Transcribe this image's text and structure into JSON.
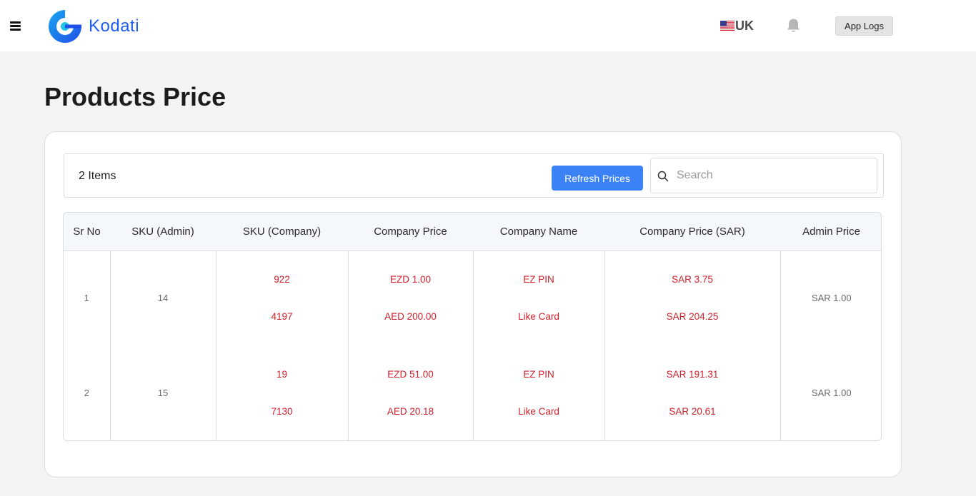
{
  "header": {
    "brand": "Kodati",
    "language": "UK",
    "app_logs_label": "App Logs"
  },
  "page": {
    "title": "Products Price"
  },
  "toolbar": {
    "items_count": "2 Items",
    "refresh_label": "Refresh Prices",
    "search_placeholder": "Search"
  },
  "table": {
    "columns": [
      "Sr No",
      "SKU (Admin)",
      "SKU (Company)",
      "Company Price",
      "Company Name",
      "Company Price (SAR)",
      "Admin Price"
    ],
    "rows": [
      {
        "sr_no": "1",
        "sku_admin": "14",
        "sku_company": [
          "922",
          "4197"
        ],
        "company_price": [
          "EZD 1.00",
          "AED 200.00"
        ],
        "company_name": [
          "EZ PIN",
          "Like Card"
        ],
        "company_price_sar": [
          "SAR 3.75",
          "SAR 204.25"
        ],
        "admin_price": "SAR 1.00"
      },
      {
        "sr_no": "2",
        "sku_admin": "15",
        "sku_company": [
          "19",
          "7130"
        ],
        "company_price": [
          "EZD 51.00",
          "AED 20.18"
        ],
        "company_name": [
          "EZ PIN",
          "Like Card"
        ],
        "company_price_sar": [
          "SAR 191.31",
          "SAR 20.61"
        ],
        "admin_price": "SAR 1.00"
      }
    ]
  },
  "icons": {
    "menu": "hamburger-icon",
    "logo": "kodati-logo",
    "flag": "us-flag-icon",
    "notifications": "bell-icon",
    "search": "search-icon"
  },
  "colors": {
    "brand": "#1f5cf0",
    "primary_button": "#3b82f6",
    "price_text": "#d0202b",
    "background": "#f4f4f4"
  }
}
